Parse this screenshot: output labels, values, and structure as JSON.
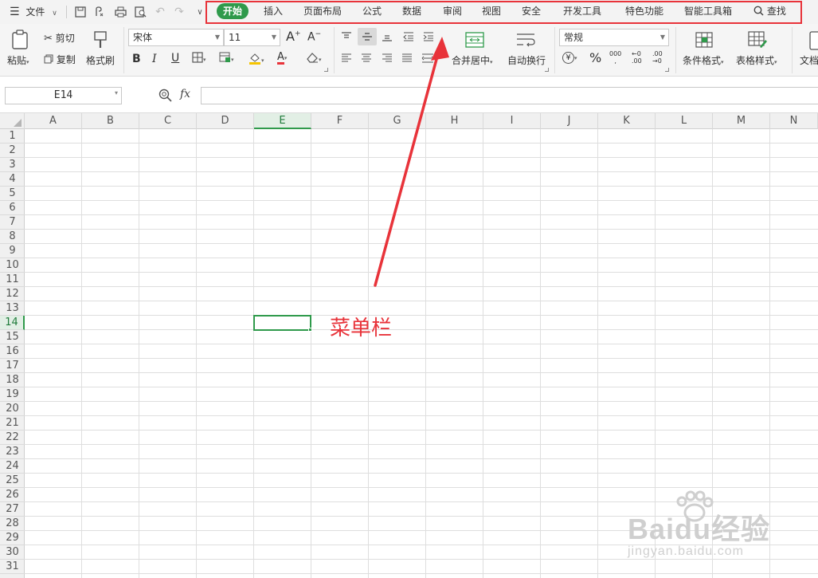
{
  "menubar": {
    "file_label": "文件",
    "tabs": [
      {
        "label": "开始",
        "active": true
      },
      {
        "label": "插入"
      },
      {
        "label": "页面布局"
      },
      {
        "label": "公式"
      },
      {
        "label": "数据"
      },
      {
        "label": "审阅"
      },
      {
        "label": "视图"
      },
      {
        "label": "安全"
      },
      {
        "label": "开发工具"
      },
      {
        "label": "特色功能"
      },
      {
        "label": "智能工具箱"
      }
    ],
    "search_label": "查找"
  },
  "ribbon": {
    "paste": "粘贴",
    "cut": "剪切",
    "copy": "复制",
    "format_painter": "格式刷",
    "font_name": "宋体",
    "font_size": "11",
    "merge_center": "合并居中",
    "wrap_text": "自动换行",
    "number_format": "常规",
    "conditional_format": "条件格式",
    "table_style": "表格样式",
    "doc_partial": "文档"
  },
  "formula_bar": {
    "name_box": "E14",
    "fx_label": "fx",
    "formula": ""
  },
  "grid": {
    "columns": [
      "A",
      "B",
      "C",
      "D",
      "E",
      "F",
      "G",
      "H",
      "I",
      "J",
      "K",
      "L",
      "M",
      "N"
    ],
    "rows": [
      "1",
      "2",
      "3",
      "4",
      "5",
      "6",
      "7",
      "8",
      "9",
      "10",
      "11",
      "12",
      "13",
      "14",
      "15",
      "16",
      "17",
      "18",
      "19",
      "20",
      "21",
      "22",
      "23",
      "24",
      "25",
      "26",
      "27",
      "28",
      "29",
      "30",
      "31"
    ],
    "active_column": "E",
    "active_row": "14"
  },
  "annotation": {
    "label": "菜单栏",
    "color": "#e8333a"
  },
  "watermark": {
    "logo": "Baidu经验",
    "url": "jingyan.baidu.com"
  },
  "colors": {
    "accent": "#2f9a4b",
    "annotation": "#e8333a"
  }
}
